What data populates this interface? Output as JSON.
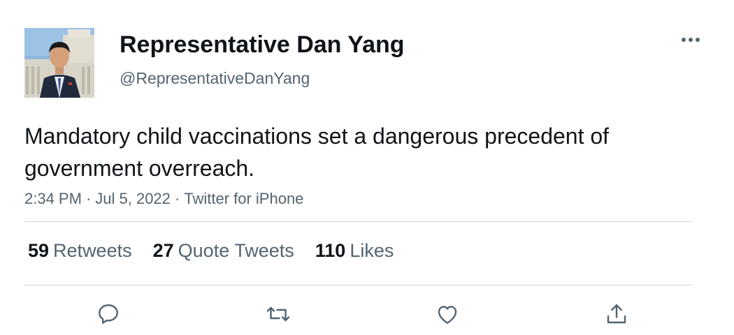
{
  "tweet": {
    "author": {
      "display_name": "Representative Dan Yang",
      "handle": "@RepresentativeDanYang"
    },
    "text": "Mandatory child vaccinations set a dangerous precedent of government overreach.",
    "meta": {
      "time": "2:34 PM",
      "separator": "·",
      "date": "Jul 5, 2022",
      "source": "Twitter for iPhone"
    },
    "stats": [
      {
        "count": "59",
        "label": "Retweets"
      },
      {
        "count": "27",
        "label": "Quote Tweets"
      },
      {
        "count": "110",
        "label": "Likes"
      }
    ],
    "actions": [
      {
        "icon": "reply-icon"
      },
      {
        "icon": "retweet-icon"
      },
      {
        "icon": "like-icon"
      },
      {
        "icon": "share-icon"
      }
    ],
    "more_icon": "more-icon"
  },
  "colors": {
    "text_primary": "#0f1419",
    "text_secondary": "#536471",
    "divider": "#cfd9de"
  }
}
